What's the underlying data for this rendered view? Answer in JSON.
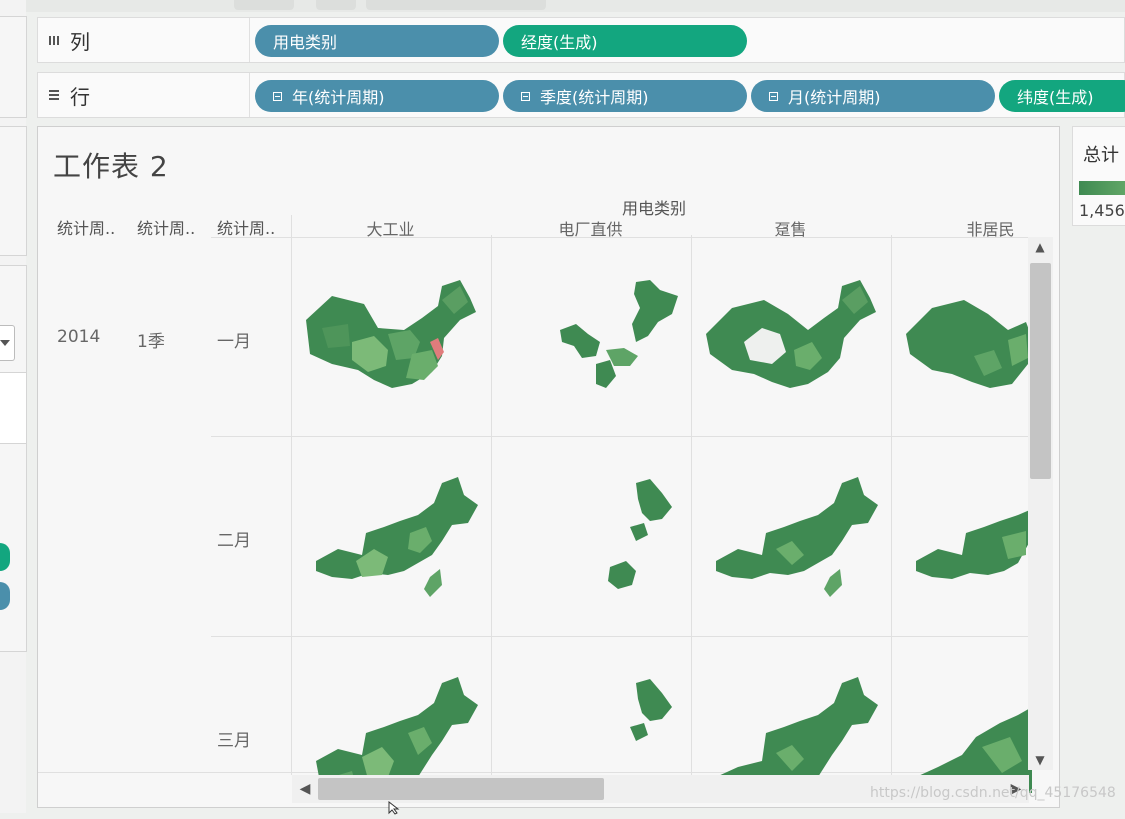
{
  "shelves": {
    "columns": {
      "label": "列",
      "pills": [
        {
          "text": "用电类别",
          "kind": "blue"
        },
        {
          "text": "经度(生成)",
          "kind": "green"
        }
      ]
    },
    "rows": {
      "label": "行",
      "pills": [
        {
          "text": "年(统计周期)",
          "kind": "blue",
          "collapsible": true
        },
        {
          "text": "季度(统计周期)",
          "kind": "blue",
          "collapsible": true
        },
        {
          "text": "月(统计周期)",
          "kind": "blue",
          "collapsible": true
        },
        {
          "text": "纬度(生成)",
          "kind": "green"
        }
      ]
    }
  },
  "worksheet": {
    "title": "工作表 2",
    "group_header": "用电类别",
    "row_headers": [
      "统计周..",
      "统计周..",
      "统计周.."
    ],
    "columns": [
      "大工业",
      "电厂直供",
      "趸售",
      "非居民"
    ],
    "year": "2014",
    "quarter": "1季",
    "months": [
      "一月",
      "二月",
      "三月"
    ]
  },
  "legend": {
    "title": "总计",
    "value": "1,456"
  },
  "colors": {
    "pill_blue": "#4b8fab",
    "pill_green": "#13a67f",
    "map_dark": "#3f8a52",
    "map_light": "#7cba78",
    "map_highlight": "#e07c7c"
  },
  "watermark": "https://blog.csdn.net/qq_45176548"
}
